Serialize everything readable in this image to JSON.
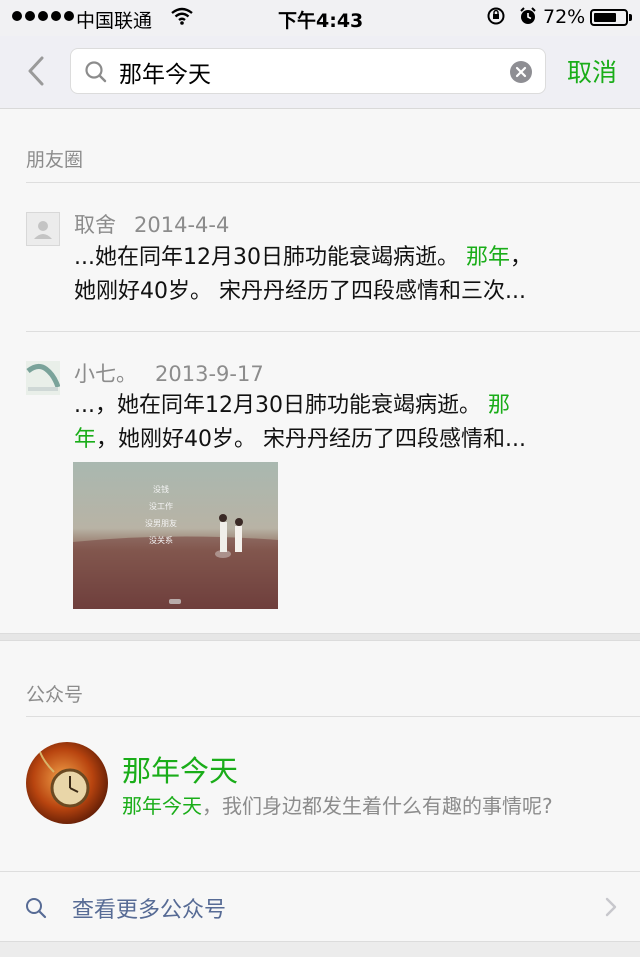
{
  "status_bar": {
    "carrier": "中国联通",
    "time": "下午4:43",
    "battery": "72%",
    "battery_level": 0.72
  },
  "search": {
    "query": "那年今天",
    "cancel_label": "取消"
  },
  "moments": {
    "section_title": "朋友圈",
    "posts": [
      {
        "author": "取舍",
        "date": "2014-4-4",
        "line1_pre": "...她在同年12月30日肺功能衰竭病逝。",
        "line1_hl": "那年",
        "line1_post": "，",
        "line2": "她刚好40岁。 宋丹丹经历了四段感情和三次..."
      },
      {
        "author": "小七。",
        "date": "2013-9-17",
        "line1_pre": "...，她在同年12月30日肺功能衰竭病逝。",
        "line1_hl": "那",
        "line2_hl": "年",
        "line2_post": "，她刚好40岁。 宋丹丹经历了四段感情和...",
        "photo_caption": [
          "没钱",
          "没工作",
          "没男朋友",
          "没关系"
        ]
      }
    ]
  },
  "official_accounts": {
    "section_title": "公众号",
    "item": {
      "name": "那年今天",
      "desc_hl": "那年今天",
      "desc_rest": "，我们身边都发生着什么有趣的事情呢?"
    },
    "more_label": "查看更多公众号"
  },
  "colors": {
    "accent_green": "#1aad19",
    "link_blue": "#576b95",
    "muted_gray": "#8c8c8c"
  },
  "icons": [
    "signal-dots-icon",
    "wifi-icon",
    "rotation-lock-icon",
    "alarm-icon",
    "battery-icon",
    "back-chevron-icon",
    "search-icon",
    "clear-icon",
    "chevron-right-icon"
  ]
}
